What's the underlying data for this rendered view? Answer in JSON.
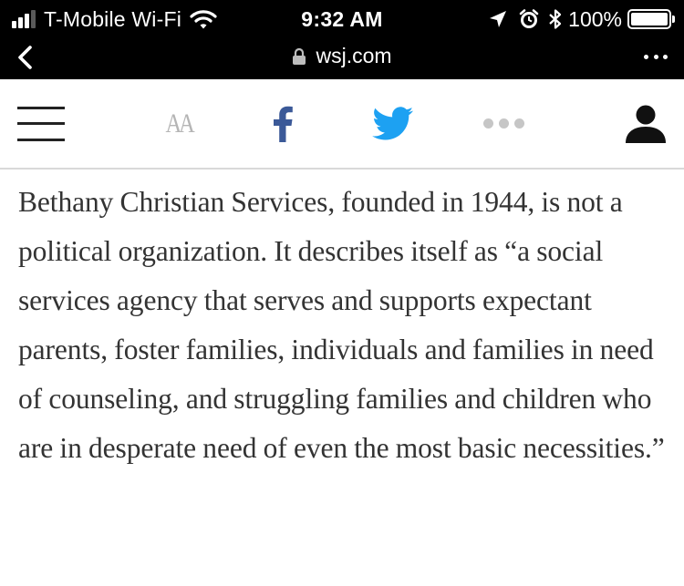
{
  "status_bar": {
    "carrier": "T-Mobile Wi-Fi",
    "time": "9:32 AM",
    "battery_percent": "100%",
    "signal_bars_filled": 3,
    "signal_bars_total": 4,
    "icons": [
      "wifi-icon",
      "location-arrow-icon",
      "alarm-icon",
      "bluetooth-icon",
      "battery-icon"
    ]
  },
  "browser": {
    "url": "wsj.com",
    "icons": [
      "back-chevron-icon",
      "lock-icon",
      "more-menu-icon"
    ]
  },
  "toolbar": {
    "text_size_label": "AA",
    "facebook_label": "f",
    "icons": [
      "hamburger-menu-icon",
      "facebook-icon",
      "twitter-icon",
      "more-share-icon",
      "profile-icon"
    ],
    "colors": {
      "facebook": "#3b5998",
      "twitter": "#1da1f2",
      "muted": "#b5b5b5"
    }
  },
  "article": {
    "paragraph": "Bethany Christian Services, founded in 1944, is not a political organization. It describes itself as “a social services agency that serves and supports expectant parents, foster families, individuals and families in need of counseling, and struggling families and children who are in desperate need of even the most basic necessities.”"
  }
}
